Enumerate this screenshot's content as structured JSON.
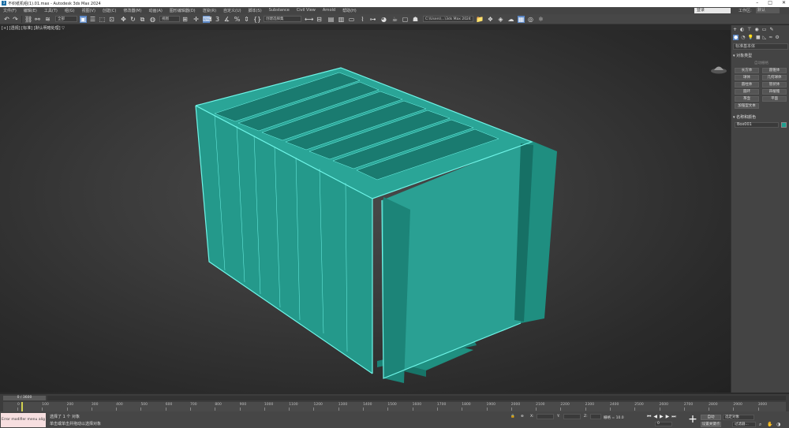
{
  "window": {
    "title": "不织纸机组(1).01.max - Autodesk 3ds Max 2024",
    "app_icon": "3"
  },
  "menu": {
    "items": [
      "文件(F)",
      "编辑(E)",
      "工具(T)",
      "组(G)",
      "视图(V)",
      "创建(C)",
      "修改器(M)",
      "动画(A)",
      "图形编辑器(D)",
      "渲染(R)",
      "自定义(U)",
      "脚本(S)",
      "Substance",
      "Civil View",
      "Arnold",
      "帮助(H)"
    ],
    "search_value": "登录",
    "workspace_label": "工作区:",
    "workspace_value": "默认"
  },
  "toolbar": {
    "selection_filter": "全部",
    "view_coord": "视图",
    "named_selection": "创建选择集",
    "render_preset": "C:\\Users\\...\\3ds Max 2024"
  },
  "viewport": {
    "label": "[+] [透视] [标准] [默认明暗处理]  ▽",
    "model_color": "#2aa093",
    "wire_color": "#6ff5e8"
  },
  "command_panel": {
    "dropdown": "标准基本体",
    "rollout_object_type": "对象类型",
    "autogrid": "自动栅格",
    "buttons": [
      "长方体",
      "圆锥体",
      "球体",
      "几何球体",
      "圆柱体",
      "管状体",
      "圆环",
      "四棱锥",
      "茶壶",
      "平面",
      "加强型文本"
    ],
    "rollout_name_color": "名称和颜色",
    "name_value": "Box001",
    "swatch_color": "#20a090"
  },
  "timeline": {
    "frame_display": "0 / 3600",
    "ticks": [
      "0",
      "100",
      "200",
      "300",
      "400",
      "500",
      "600",
      "700",
      "800",
      "900",
      "1000",
      "1100",
      "1200",
      "1300",
      "1400",
      "1500",
      "1600",
      "1700",
      "1800",
      "1900",
      "2000",
      "2100",
      "2200",
      "2300",
      "2400",
      "2500",
      "2600",
      "2700",
      "2800",
      "2900",
      "3000"
    ]
  },
  "status": {
    "maxscript": "Error modifier menu alig",
    "selection_info": "选择了 1 个 对象",
    "prompt": "单击或单击并拖动以选择对象",
    "x_label": "X:",
    "y_label": "Y:",
    "z_label": "Z:",
    "grid": "栅格 = 10.0",
    "frame_value": "0",
    "auto_key": "自动",
    "set_key": "设置关键点",
    "key_mode": "选定对象",
    "key_filter": "过滤器..."
  }
}
